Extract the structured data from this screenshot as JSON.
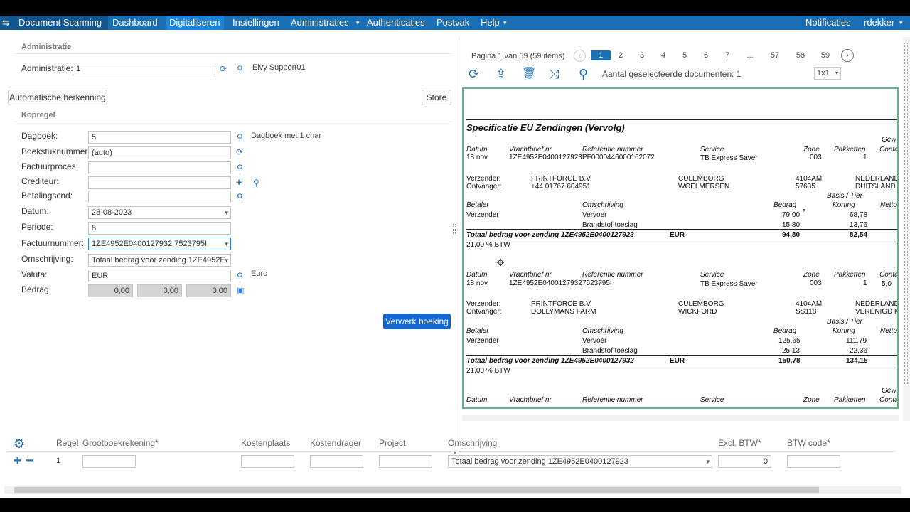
{
  "nav": {
    "app_title": "Document Scanning",
    "items": [
      "Dashboard",
      "Digitaliseren",
      "Instellingen",
      "Administraties",
      "Authenticaties",
      "Postvak",
      "Help"
    ],
    "notifications": "Notificaties",
    "user": "rdekker"
  },
  "form": {
    "admin_section": "Administratie",
    "admin_label": "Administratie:",
    "admin_value": "1",
    "admin_name": "Elvy Support01",
    "auto_button": "Automatische herkenning",
    "store_button": "Store",
    "kopregel_section": "Kopregel",
    "fields": {
      "dagboek": {
        "label": "Dagboek:",
        "value": "5",
        "side": "Dagboek met 1 char"
      },
      "boekstuk": {
        "label": "Boekstuknummer:",
        "value": "(auto)"
      },
      "factuurproces": {
        "label": "Factuurproces:",
        "value": ""
      },
      "crediteur": {
        "label": "Crediteur:",
        "value": ""
      },
      "betalingscnd": {
        "label": "Betalingscnd:",
        "value": ""
      },
      "datum": {
        "label": "Datum:",
        "value": "28-08-2023"
      },
      "periode": {
        "label": "Periode:",
        "value": "8"
      },
      "factuurnummer": {
        "label": "Factuurnummer:",
        "value": "1ZE4952E0400127932 7523795I"
      },
      "omschrijving": {
        "label": "Omschrijving:",
        "value": "Totaal bedrag voor zending 1ZE4952E"
      },
      "valuta": {
        "label": "Valuta:",
        "value": "EUR",
        "side": "Euro"
      },
      "bedrag": {
        "label": "Bedrag:",
        "values": [
          "0,00",
          "0,00",
          "0,00"
        ]
      }
    },
    "submit_button": "Verwerk boeking"
  },
  "viewer": {
    "page_info": "Pagina 1 van 59 (59 items)",
    "pages": [
      "1",
      "2",
      "3",
      "4",
      "5",
      "6",
      "7",
      "...",
      "57",
      "58",
      "59"
    ],
    "current_page": "1",
    "selected_text": "Aantal geselecteerde documenten: 1",
    "zoom": "1x1",
    "document": {
      "title": "Specificatie EU Zendingen (Vervolg)",
      "gew": "Gew",
      "conta": "Conta",
      "headers": {
        "datum": "Datum",
        "vrachtbrief": "Vrachtbrief nr",
        "referentie": "Referentie nummer",
        "service": "Service",
        "zone": "Zone",
        "pakketten": "Pakketten"
      },
      "lbl_verzender": "Verzender:",
      "lbl_ontvanger": "Ontvanger:",
      "basis": "Basis / Tier",
      "betaler": "Betaler",
      "omschrijving": "Omschrijving",
      "bedrag": "Bedrag",
      "korting": "Korting",
      "netto": "Netto",
      "verzender_word": "Verzender",
      "vervoer": "Vervoer",
      "brandstof": "Brandstof toeslag",
      "eur": "EUR",
      "btw": "21,00 % BTW",
      "block1": {
        "datum": "18 nov",
        "vrachtbrief": "1ZE4952E0400127923",
        "referentie": "PF0000446000162072",
        "service": "TB Express Saver",
        "zone": "003",
        "pakketten": "1",
        "verzender_name": "PRINTFORCE B.V.",
        "verzender_city": "CULEMBORG",
        "verzender_zip": "4104AM",
        "verzender_country": "NEDERLAND",
        "ontvanger_name": "+44 01767 604951",
        "ontvanger_city": "WOELMERSEN",
        "ontvanger_zip": "57635",
        "ontvanger_country": "DUITSLAND",
        "vervoer_bedrag": "79,00",
        "vervoer_mark": "F",
        "vervoer_korting": "68,78",
        "brandstof_bedrag": "15,80",
        "brandstof_korting": "13,76",
        "totaal": "Totaal bedrag voor zending 1ZE4952E0400127923",
        "totaal_bedrag": "94,80",
        "totaal_korting": "82,54"
      },
      "block2": {
        "datum": "18 nov",
        "vrachtbrief": "1ZE4952E0400127932",
        "referentie": "7523795I",
        "service": "TB Express Saver",
        "zone": "003",
        "pakketten": "1",
        "gew": "5,0",
        "verzender_name": "PRINTFORCE B.V.",
        "verzender_city": "CULEMBORG",
        "verzender_zip": "4104AM",
        "verzender_country": "NEDERLAND",
        "ontvanger_name": "DOLLYMANS FARM",
        "ontvanger_city": "WICKFORD",
        "ontvanger_zip": "SS118",
        "ontvanger_country": "VERENIGD K",
        "vervoer_bedrag": "125,65",
        "vervoer_korting": "111,79",
        "brandstof_bedrag": "25,13",
        "brandstof_korting": "22,36",
        "totaal": "Totaal bedrag voor zending 1ZE4952E0400127932",
        "totaal_bedrag": "150,78",
        "totaal_korting": "134,15"
      }
    }
  },
  "grid": {
    "headers": [
      "Regel",
      "Grootboekrekening*",
      "Kostenplaats",
      "Kostendrager",
      "Project",
      "Omschrijving",
      "Excl. BTW*",
      "BTW code*"
    ],
    "row": {
      "regel": "1",
      "omschrijving": "Totaal bedrag voor zending 1ZE4952E0400127923",
      "excl": "0"
    }
  },
  "colors": {
    "nav_bg": "#1a6fb5",
    "primary": "#1468d2",
    "doc_border": "#62b38a"
  }
}
